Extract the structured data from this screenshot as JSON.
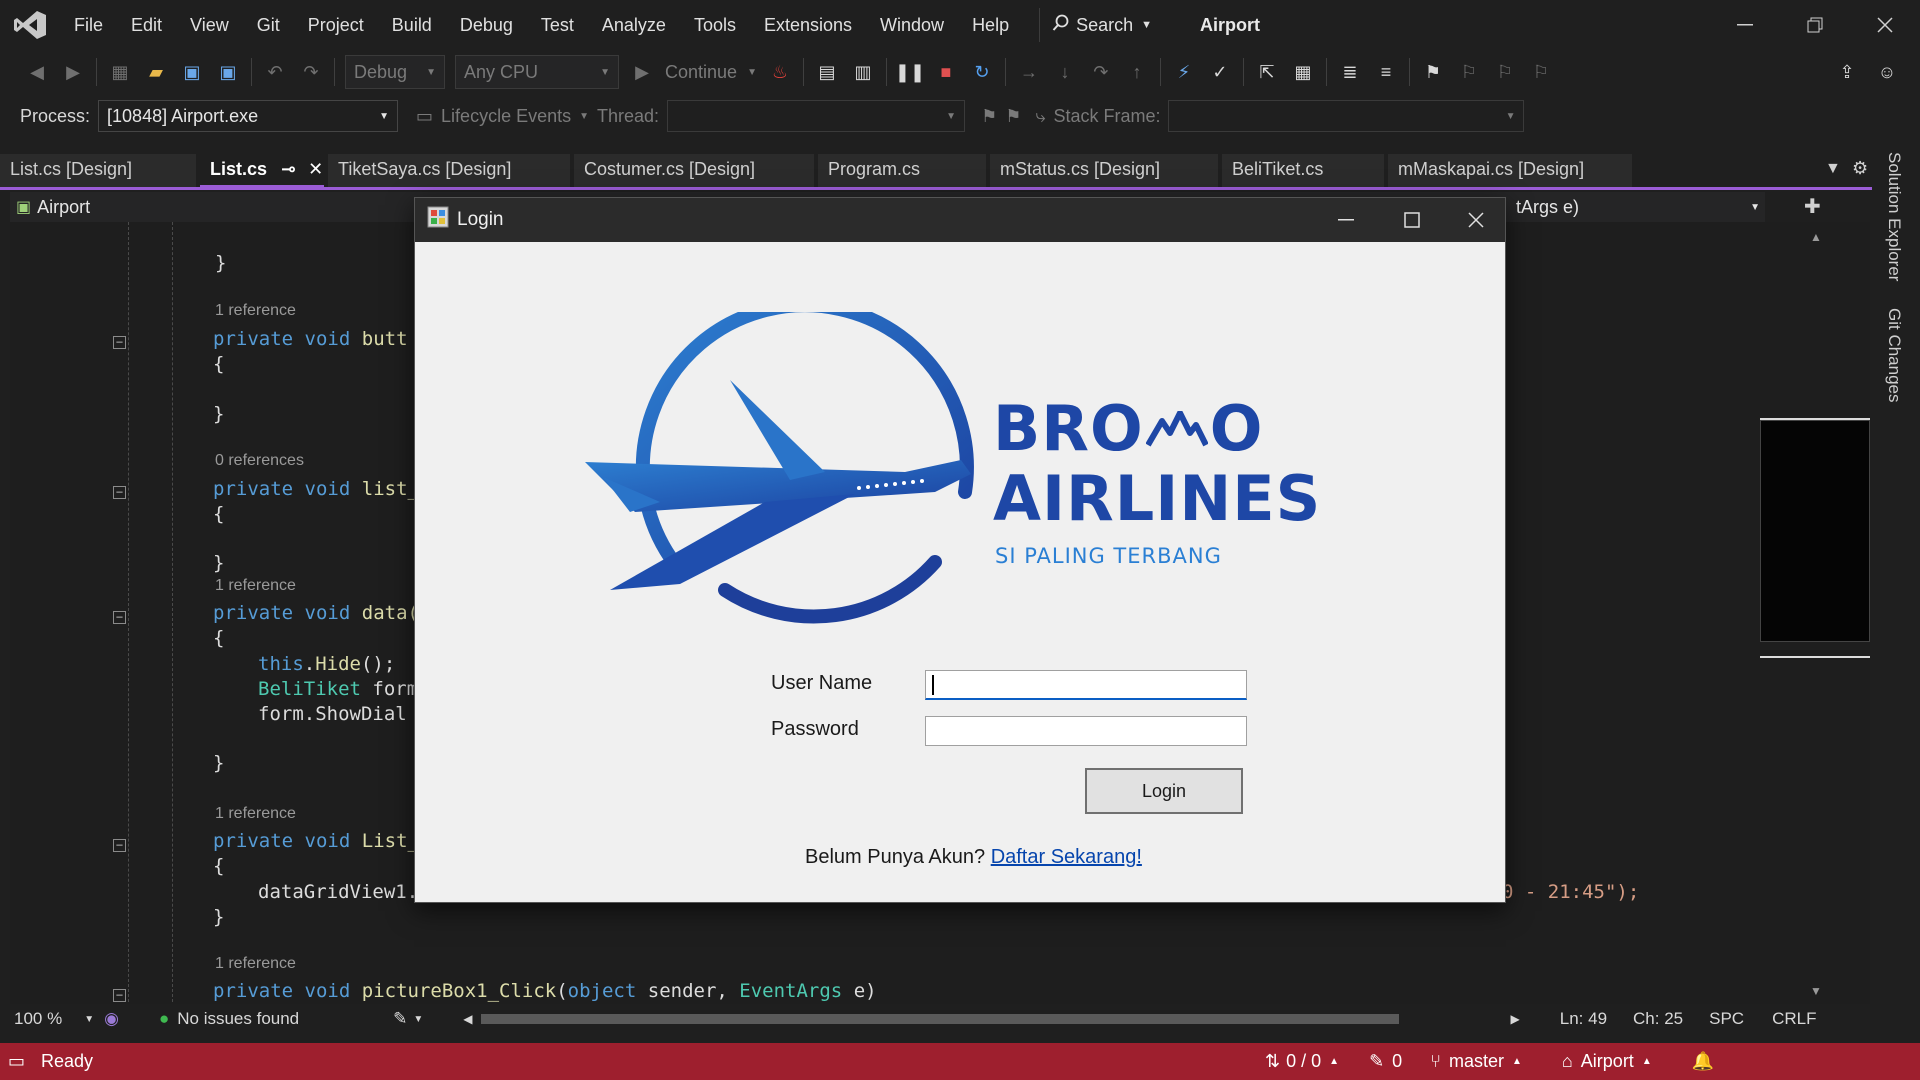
{
  "titlebar": {
    "menu": [
      "File",
      "Edit",
      "View",
      "Git",
      "Project",
      "Build",
      "Debug",
      "Test",
      "Analyze",
      "Tools",
      "Extensions",
      "Window",
      "Help"
    ],
    "search_label": "Search",
    "solution_name": "Airport"
  },
  "toolbar": {
    "config": "Debug",
    "platform": "Any CPU",
    "continue_label": "Continue"
  },
  "debugbar": {
    "process_label": "Process:",
    "process_value": "[10848] Airport.exe",
    "lifecycle_label": "Lifecycle Events",
    "thread_label": "Thread:",
    "stackframe_label": "Stack Frame:"
  },
  "tabs": [
    {
      "label": "List.cs [Design]"
    },
    {
      "label": "List.cs"
    },
    {
      "label": "TiketSaya.cs [Design]"
    },
    {
      "label": "Costumer.cs [Design]"
    },
    {
      "label": "Program.cs"
    },
    {
      "label": "mStatus.cs [Design]"
    },
    {
      "label": "BeliTiket.cs"
    },
    {
      "label": "mMaskapai.cs [Design]"
    }
  ],
  "navbar": {
    "project": "Airport",
    "member": "tArgs e)"
  },
  "code": {
    "refs": [
      "1 reference",
      "0 references",
      "1 reference",
      "1 reference",
      "1 reference"
    ],
    "line_button": "butt",
    "line_list": "list_",
    "line_data": "data(",
    "hide": "Hide",
    "belitiket": "BeliTiket",
    "form_partial": "form",
    "showdialog": "form.ShowDial",
    "list_partial": "List_",
    "datagrid": "dataGridView1.",
    "string_tail": "0 - 21:45\");",
    "picturebox": "pictureBox1_Click",
    "object_kw": "object",
    "sender": "sender",
    "eventargs": "EventArgs",
    "e": "e"
  },
  "editor_status": {
    "zoom": "100 %",
    "issues": "No issues found",
    "ln": "Ln: 49",
    "ch": "Ch: 25",
    "spc": "SPC",
    "crlf": "CRLF"
  },
  "statusbar": {
    "ready": "Ready",
    "changes": "0 / 0",
    "pencil_count": "0",
    "branch": "master",
    "repo": "Airport"
  },
  "sidetabs": [
    "Solution Explorer",
    "Git Changes"
  ],
  "dialog": {
    "title": "Login",
    "brand_line1": "BRO",
    "brand_line1_end": "O",
    "brand_line2": "AIRLINES",
    "tagline": "SI PALING TERBANG",
    "username_label": "User Name",
    "password_label": "Password",
    "username_value": "",
    "password_value": "",
    "login_button": "Login",
    "signup_prompt": "Belum Punya Akun?",
    "signup_link": "Daftar Sekarang!"
  },
  "colors": {
    "accent_purple": "#9b5cd6",
    "statusbar_red": "#9e1f2e",
    "brand_blue": "#1e5bb8"
  }
}
